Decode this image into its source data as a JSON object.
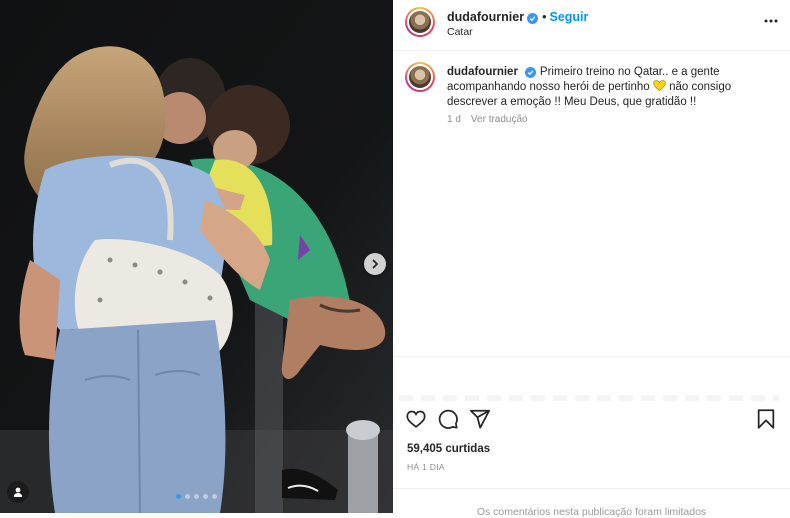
{
  "post": {
    "username": "dudafournier",
    "follow_label": "Seguir",
    "bullet": "•",
    "location": "Catar",
    "caption": {
      "username": "dudafournier",
      "text_before_emoji": "Primeiro treino no Qatar.. e a gente acompanhando nosso herói de pertinho",
      "emoji": "yellow-heart-icon",
      "text_after_emoji": "não consigo descrever a emoção !! Meu Deus, que gratidão !!"
    },
    "caption_age": "1 d",
    "translate_label": "Ver tradução",
    "likes": "59,405 curtidas",
    "timestamp": "HÁ 1 DIA",
    "comments_limited": "Os comentários nesta publicação foram limitados"
  },
  "carousel": {
    "slide_count": 5,
    "active_index": 0
  },
  "icons": {
    "like": "heart-icon",
    "comment": "comment-icon",
    "share": "share-icon",
    "save": "bookmark-icon",
    "more": "more-options-icon",
    "next": "chevron-right-icon",
    "tag": "user-tag-icon",
    "verified": "verified-badge-icon"
  },
  "colors": {
    "follow": "#0095f6",
    "verified": "#3897f0",
    "muted": "#8e8e8e",
    "carousel_active": "#3a97f0"
  }
}
